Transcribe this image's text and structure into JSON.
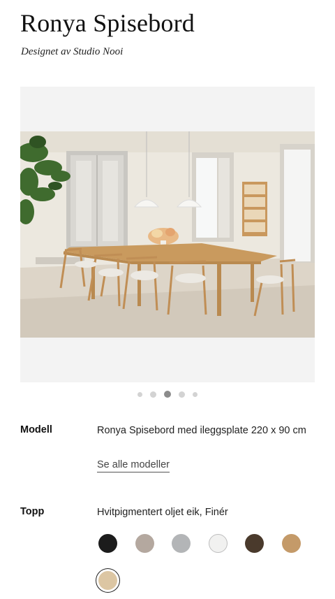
{
  "product": {
    "title": "Ronya Spisebord",
    "subtitle": "Designet av Studio Nooi"
  },
  "gallery": {
    "image_alt": "Ronya Spisebord dining table in bright room with chairs",
    "dot_count": 5,
    "active_index": 2
  },
  "specs": {
    "model_label": "Modell",
    "model_value": "Ronya Spisebord med ileggsplate 220 x 90 cm",
    "see_all_link": "Se alle modeller",
    "top_label": "Topp",
    "top_value": "Hvitpigmentert oljet eik, Finér"
  },
  "swatches": [
    {
      "name": "black",
      "color": "#1c1c1c"
    },
    {
      "name": "taupe",
      "color": "#b4a89f"
    },
    {
      "name": "grey",
      "color": "#b3b5b7"
    },
    {
      "name": "white",
      "color": "#f1f1f0"
    },
    {
      "name": "dark-brown",
      "color": "#4a3a2c"
    },
    {
      "name": "oak",
      "color": "#c49a69"
    },
    {
      "name": "white-pigmented-oak",
      "color": "#dcc6a3",
      "selected": true
    }
  ]
}
